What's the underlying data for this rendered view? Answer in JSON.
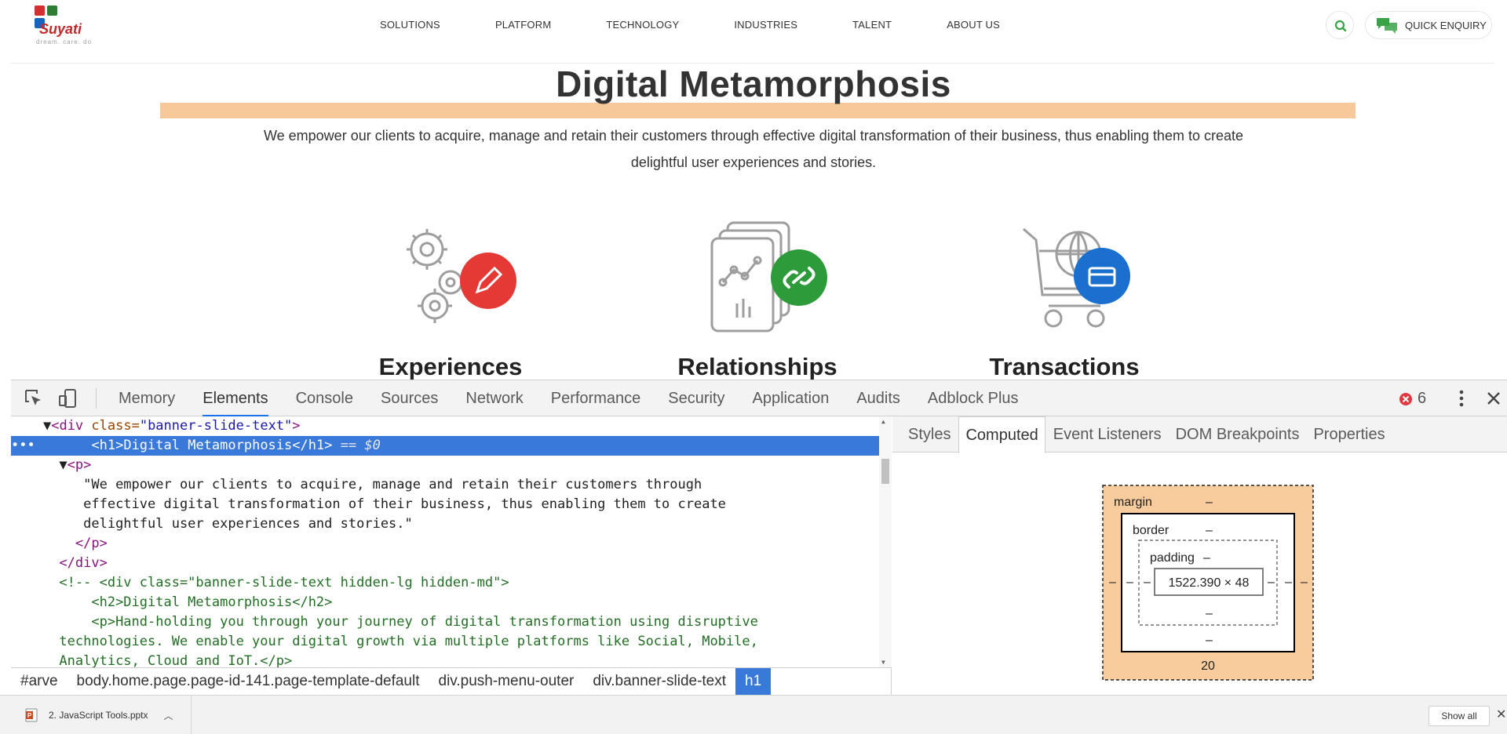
{
  "site": {
    "logo": {
      "word": "Suyati",
      "tagline": "dream. care. do",
      "colors": [
        "#d32f2f",
        "#2e7d32",
        "#1565c0",
        "#2e7d32"
      ]
    },
    "nav": [
      "SOLUTIONS",
      "PLATFORM",
      "TECHNOLOGY",
      "INDUSTRIES",
      "TALENT",
      "ABOUT US"
    ],
    "enquiry_label": "QUICK ENQUIRY",
    "hero": {
      "title": "Digital Metamorphosis",
      "text": "We empower our clients to acquire, manage and retain their customers through effective digital transformation of their business, thus enabling them to create delightful user experiences and stories."
    },
    "features": [
      {
        "label": "Experiences",
        "icon": "gears-pencil-icon",
        "badge_color": "#e53935"
      },
      {
        "label": "Relationships",
        "icon": "cards-link-icon",
        "badge_color": "#2e9b3a"
      },
      {
        "label": "Transactions",
        "icon": "cart-card-icon",
        "badge_color": "#1a6fcf"
      }
    ]
  },
  "devtools": {
    "tabs": [
      "Memory",
      "Elements",
      "Console",
      "Sources",
      "Network",
      "Performance",
      "Security",
      "Application",
      "Audits",
      "Adblock Plus"
    ],
    "active_tab": "Elements",
    "error_count": "6",
    "code": {
      "l1_open": "<",
      "l1_tag": "div",
      "l1_attr": " class=",
      "l1_val": "\"banner-slide-text\"",
      "l1_close": ">",
      "l2_ellipsis": "•••",
      "l2_open": "<h1>",
      "l2_text": "Digital Metamorphosis",
      "l2_close": "</h1>",
      "l2_suffix": " == $0",
      "l3_tag": "<p>",
      "l4": "\"We empower our clients to acquire, manage and retain their customers through",
      "l5": "effective digital transformation of their business, thus enabling them to create",
      "l6": "delightful user experiences and stories.\"",
      "l7": "</p>",
      "l8": "</div>",
      "l9": "<!-- <div class=\"banner-slide-text hidden-lg hidden-md\">",
      "l10": "<h2>Digital Metamorphosis</h2>",
      "l11": "<p>Hand-holding you through your journey of digital transformation using disruptive",
      "l12": "technologies. We enable your digital growth via multiple platforms like Social, Mobile,",
      "l13": "Analytics, Cloud and IoT.</p>"
    },
    "breadcrumbs": [
      "#arve",
      "body.home.page.page-id-141.page-template-default",
      "div.push-menu-outer",
      "div.banner-slide-text",
      "h1"
    ],
    "sidebar_tabs": [
      "Styles",
      "Computed",
      "Event Listeners",
      "DOM Breakpoints",
      "Properties"
    ],
    "sidebar_active": "Computed",
    "box_model": {
      "margin_label": "margin",
      "border_label": "border",
      "padding_label": "padding",
      "dash": "–",
      "content_size": "1522.390 × 48",
      "margin_bottom": "20",
      "margin_color": "#f9cc9d"
    }
  },
  "downloads": {
    "file_name": "2. JavaScript Tools.pptx",
    "show_all": "Show all"
  }
}
